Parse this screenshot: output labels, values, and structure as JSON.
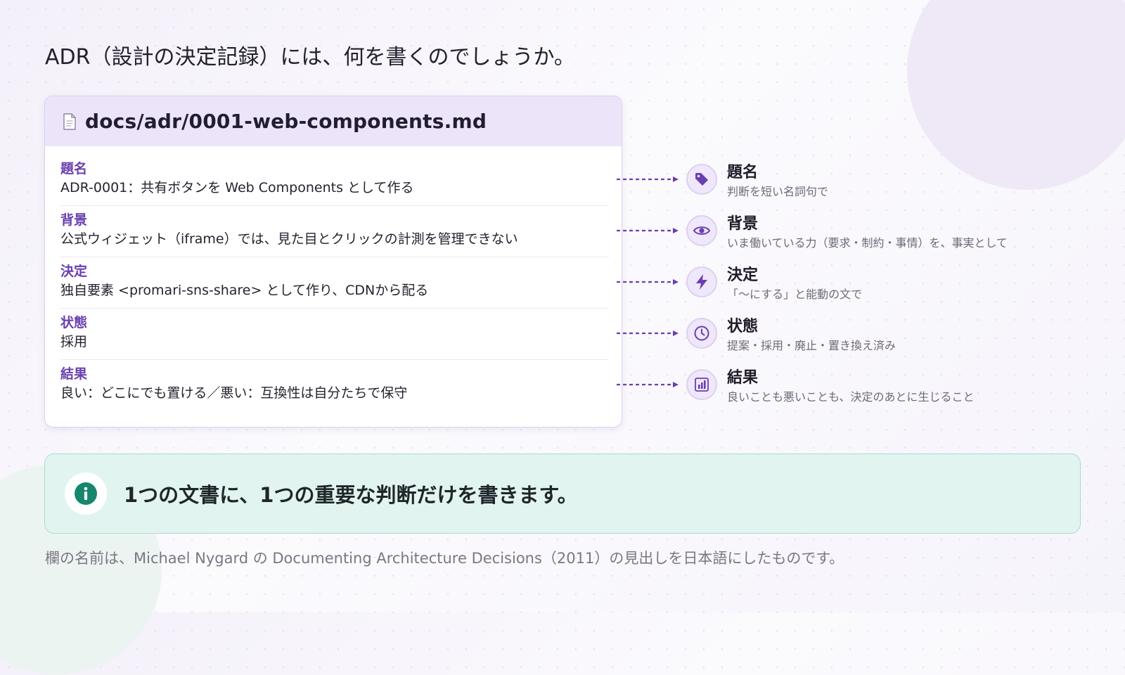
{
  "title": "ADR（設計の決定記録）には、何を書くのでしょうか。",
  "document": {
    "filename": "docs/adr/0001-web-components.md",
    "icon": "file-icon",
    "fields": [
      {
        "label": "題名",
        "value": "ADR-0001：共有ボタンを Web Components として作る"
      },
      {
        "label": "背景",
        "value": "公式ウィジェット（iframe）では、見た目とクリックの計測を管理できない"
      },
      {
        "label": "決定",
        "value": "独自要素 <promari-sns-share> として作り、CDNから配る"
      },
      {
        "label": "状態",
        "value": "採用"
      },
      {
        "label": "結果",
        "value": "良い：どこにでも置ける／悪い：互換性は自分たちで保守"
      }
    ]
  },
  "legend": [
    {
      "icon": "tag-icon",
      "title": "題名",
      "description": "判断を短い名詞句で"
    },
    {
      "icon": "eye-icon",
      "title": "背景",
      "description": "いま働いている力（要求・制約・事情）を、事実として"
    },
    {
      "icon": "lightning-icon",
      "title": "決定",
      "description": "「〜にする」と能動の文で"
    },
    {
      "icon": "clock-icon",
      "title": "状態",
      "description": "提案・採用・廃止・置き換え済み"
    },
    {
      "icon": "bar-chart-icon",
      "title": "結果",
      "description": "良いことも悪いことも、決定のあとに生じること"
    }
  ],
  "callout": {
    "icon": "info-icon",
    "text": "1つの文書に、1つの重要な判断だけを書きます。"
  },
  "footnote": "欄の名前は、Michael Nygard の Documenting Architecture Decisions（2011）の見出しを日本語にしたものです。",
  "colors": {
    "accent_purple": "#6a3fb0",
    "connector": "#6a3fb0",
    "callout_bg": "#e2f4f0",
    "info_green": "#16876e"
  }
}
